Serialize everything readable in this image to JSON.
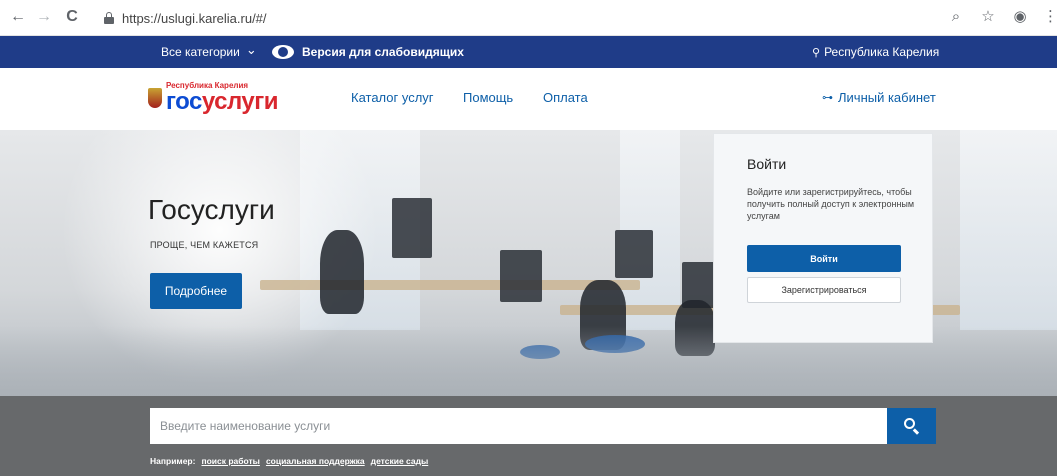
{
  "browser": {
    "url": "https://uslugi.karelia.ru/#/",
    "back": "←",
    "forward": "→",
    "reload": "C",
    "zoom_icon": "⌕",
    "star_icon": "☆",
    "account_icon": "◉",
    "menu_icon": "⋮"
  },
  "topbar": {
    "categories": "Все категории",
    "categories_chevron": "⌄",
    "vision": "Версия для слабовидящих",
    "region": "Республика Карелия",
    "region_pin": "⚲"
  },
  "header": {
    "logo_small": "Республика Карелия",
    "logo_big_1": "гос",
    "logo_big_2": "услуги",
    "nav": [
      "Каталог услуг",
      "Помощь",
      "Оплата"
    ],
    "cabinet": "Личный кабинет",
    "cabinet_key": "⊶"
  },
  "hero": {
    "title": "Госуслуги",
    "subtitle": "ПРОЩЕ, ЧЕМ КАЖЕТСЯ",
    "button": "Подробнее"
  },
  "login": {
    "title": "Войти",
    "text": "Войдите или зарегистрируйтесь, чтобы получить полный доступ к электронным услугам",
    "login_button": "Войти",
    "register_button": "Зарегистрироваться"
  },
  "search": {
    "placeholder": "Введите наименование услуги",
    "examples_label": "Например:",
    "examples": [
      "поиск работы",
      "социальная поддержка",
      "детские сады"
    ]
  },
  "colors": {
    "topbar": "#1f3c88",
    "primary": "#0d5fa8",
    "logo_blue": "#0d4cd3",
    "logo_red": "#d9272e"
  }
}
